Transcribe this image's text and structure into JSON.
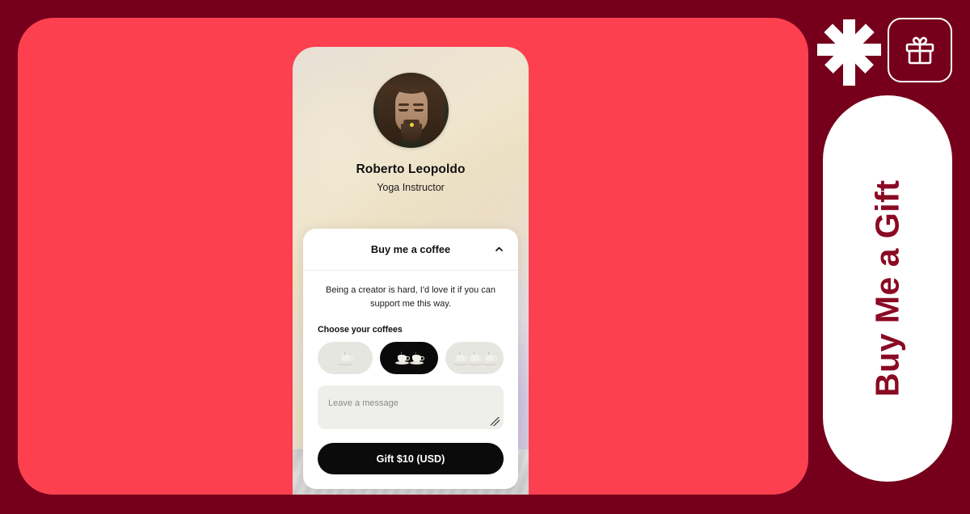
{
  "theme": {
    "outer_background": "#76001b",
    "panel_background": "#fd4050",
    "brand_maroon": "#8a0a23",
    "accent_black": "#0b0b0b",
    "card_background": "#ffffff"
  },
  "phone": {
    "profile": {
      "avatar_alt": "portrait-of-creator",
      "name": "Roberto Leopoldo",
      "role": "Yoga Instructor"
    },
    "widget": {
      "title": "Buy me a coffee",
      "collapse_icon": "chevron-up-icon",
      "description": "Being a creator is hard, I'd love it if you can support me this way.",
      "choose_label": "Choose your coffees",
      "coffee_options": [
        {
          "id": "one-coffee",
          "count": 1,
          "selected": false
        },
        {
          "id": "two-coffees",
          "count": 2,
          "selected": true
        },
        {
          "id": "three-coffees",
          "count": 3,
          "selected": false
        }
      ],
      "message": {
        "value": "",
        "placeholder": "Leave a message"
      },
      "submit_label": "Gift $10 (USD)"
    }
  },
  "rail": {
    "brand_logo_icon": "asterisk-logo-icon",
    "gift_icon": "gift-box-icon",
    "pill_label": "Buy Me a Gift"
  }
}
